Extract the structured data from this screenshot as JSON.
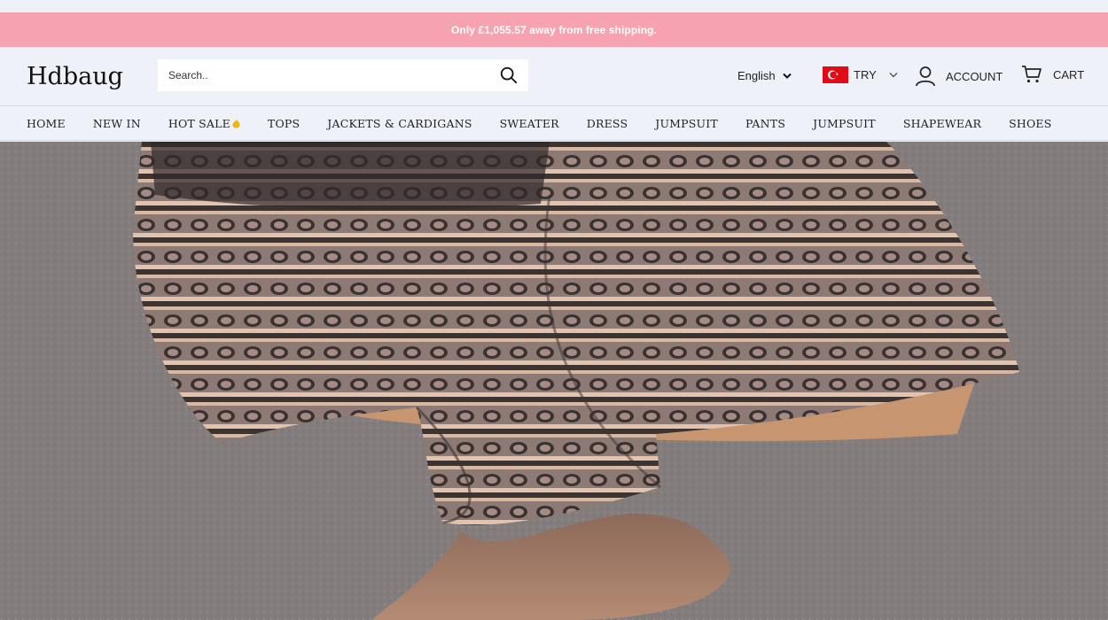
{
  "announcement": {
    "text": "Only £1,055.57 away from free shipping."
  },
  "header": {
    "logo": "Hdbaug",
    "search": {
      "placeholder": "Search..",
      "value": ""
    },
    "language": {
      "label": "English"
    },
    "currency": {
      "label": "TRY",
      "flag_color": "#e30a17"
    },
    "account": {
      "label": "ACCOUNT"
    },
    "cart": {
      "label": "CART"
    }
  },
  "nav": {
    "items": [
      {
        "label": "HOME"
      },
      {
        "label": "NEW IN"
      },
      {
        "label": "HOT SALE"
      },
      {
        "label": "TOPS"
      },
      {
        "label": "JACKETS & CARDIGANS"
      },
      {
        "label": "SWEATER"
      },
      {
        "label": "DRESS"
      },
      {
        "label": "JUMPSUIT"
      },
      {
        "label": "PANTS"
      },
      {
        "label": "JUMPSUIT"
      },
      {
        "label": "SHAPEWEAR"
      },
      {
        "label": "SHOES"
      }
    ],
    "hot_sale_icon": "fire-icon"
  },
  "colors": {
    "announcement_bg": "#f7a2b0",
    "header_bg": "#eef2f8"
  }
}
